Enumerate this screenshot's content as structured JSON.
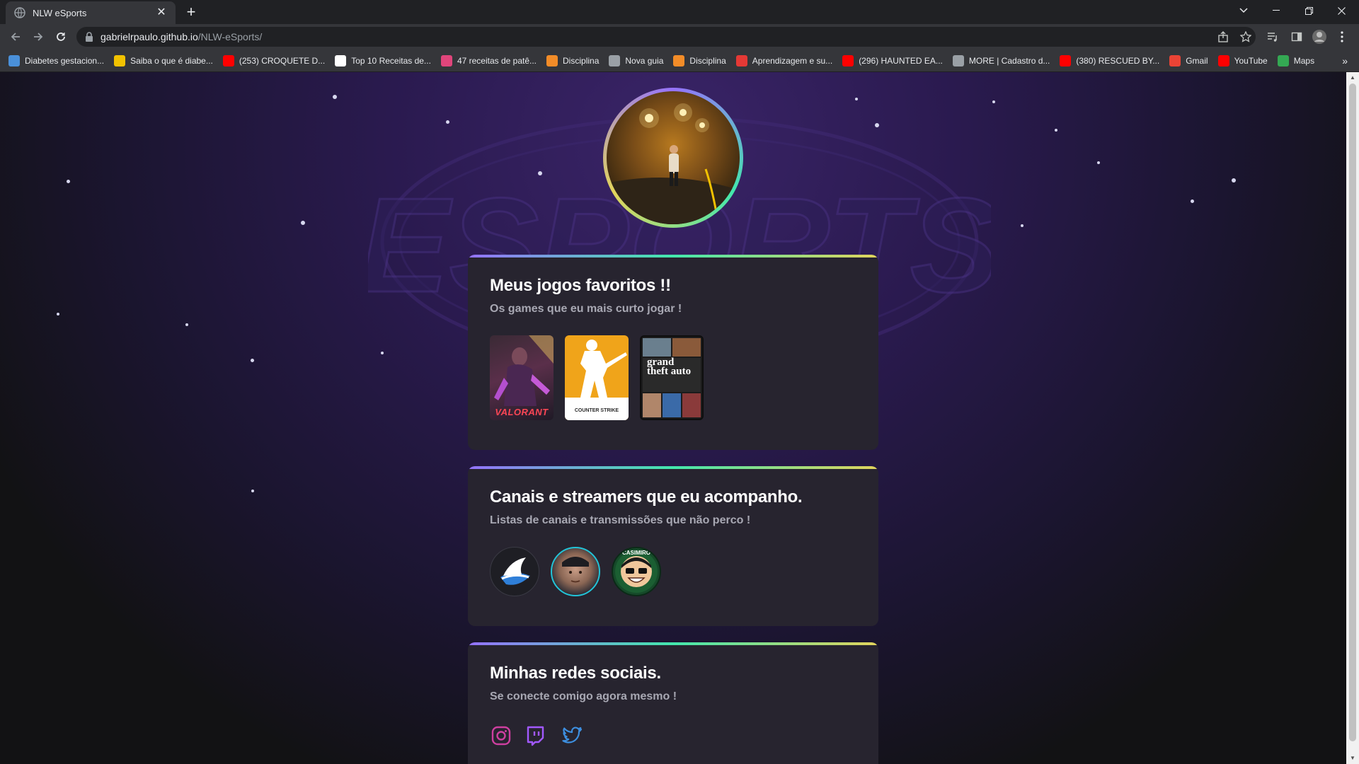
{
  "browser": {
    "tab_title": "NLW eSports",
    "tab_close": "✕",
    "new_tab": "+",
    "url_host": "gabrielrpaulo.github.io",
    "url_path": "/NLW-eSports/",
    "bookmarks_more": "»",
    "bookmarks": [
      {
        "label": "Diabetes gestacion...",
        "color": "#4a90d9"
      },
      {
        "label": "Saiba o que é diabe...",
        "color": "#f2c200"
      },
      {
        "label": "(253) CROQUETE D...",
        "color": "#ff0000"
      },
      {
        "label": "Top 10 Receitas de...",
        "color": "#ffffff"
      },
      {
        "label": "47 receitas de patê...",
        "color": "#e0457b"
      },
      {
        "label": "Disciplina",
        "color": "#f28c28"
      },
      {
        "label": "Nova guia",
        "color": "#9aa0a6"
      },
      {
        "label": "Disciplina",
        "color": "#f28c28"
      },
      {
        "label": "Aprendizagem e su...",
        "color": "#e53935"
      },
      {
        "label": "(296) HAUNTED EA...",
        "color": "#ff0000"
      },
      {
        "label": "MORE | Cadastro d...",
        "color": "#9aa0a6"
      },
      {
        "label": "(380) RESCUED BY...",
        "color": "#ff0000"
      },
      {
        "label": "Gmail",
        "color": "#ea4335"
      },
      {
        "label": "YouTube",
        "color": "#ff0000"
      },
      {
        "label": "Maps",
        "color": "#34a853"
      }
    ]
  },
  "games": {
    "title": "Meus jogos favoritos !!",
    "subtitle": "Os games que eu mais curto jogar !",
    "items": [
      {
        "name": "VALORANT"
      },
      {
        "name": "COUNTER STRIKE"
      },
      {
        "name": "grand theft auto"
      }
    ]
  },
  "streamers": {
    "title": "Canais e streamers que eu acompanho.",
    "subtitle": "Listas de canais e transmissões que não perco !",
    "items": [
      {
        "name": "CASIMIRO"
      }
    ]
  },
  "socials": {
    "title": "Minhas redes sociais.",
    "subtitle": "Se conecte comigo agora mesmo !",
    "items": [
      {
        "icon": "instagram-icon",
        "color": "#ce3fa0"
      },
      {
        "icon": "twitch-icon",
        "color": "#a259ff"
      },
      {
        "icon": "twitter-icon",
        "color": "#3d8fe0"
      }
    ]
  }
}
